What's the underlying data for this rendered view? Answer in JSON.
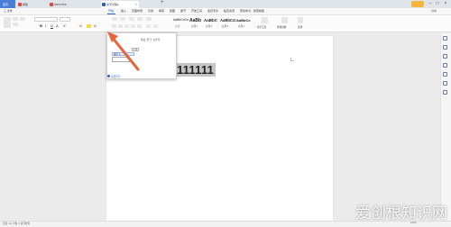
{
  "titlebar": {
    "tabs": [
      {
        "label": "首页"
      },
      {
        "label": "模板"
      },
      {
        "label": "WPS PDF"
      },
      {
        "label": "文字文稿1"
      }
    ],
    "add_tab": "+",
    "close": "×"
  },
  "menubar": {
    "items": [
      "三 文件",
      "开始",
      "插入",
      "页面布局",
      "引用",
      "审阅",
      "视图",
      "章节",
      "开发工具",
      "会员专享",
      "稻壳资源",
      "查找命令、搜索模板"
    ],
    "share": "分享"
  },
  "ribbon": {
    "style_samples": [
      "AaBbCcDd",
      "AaBb",
      "AaBbC",
      "AaBbCcI",
      "AaBbCc"
    ],
    "style_labels": [
      "正文",
      "标题 1",
      "标题 2",
      "标题 3",
      "标题 4"
    ],
    "text_tools": "文字工具",
    "find_replace": "查找替换",
    "select": "选择"
  },
  "document": {
    "text": "111111"
  },
  "popup": {
    "header": "预设  “符号”  对齐符",
    "label": "标准",
    "row": "编号  1.",
    "footer": "项目符号"
  },
  "statusbar": {
    "left": "页面: 1/1   字数: 6   拼写检查",
    "right": "100%"
  },
  "watermark": "爱创根知识网",
  "colors": {
    "accent": "#2a62c9",
    "arrow": "#e8643c",
    "selection": "#c5c5c5"
  }
}
